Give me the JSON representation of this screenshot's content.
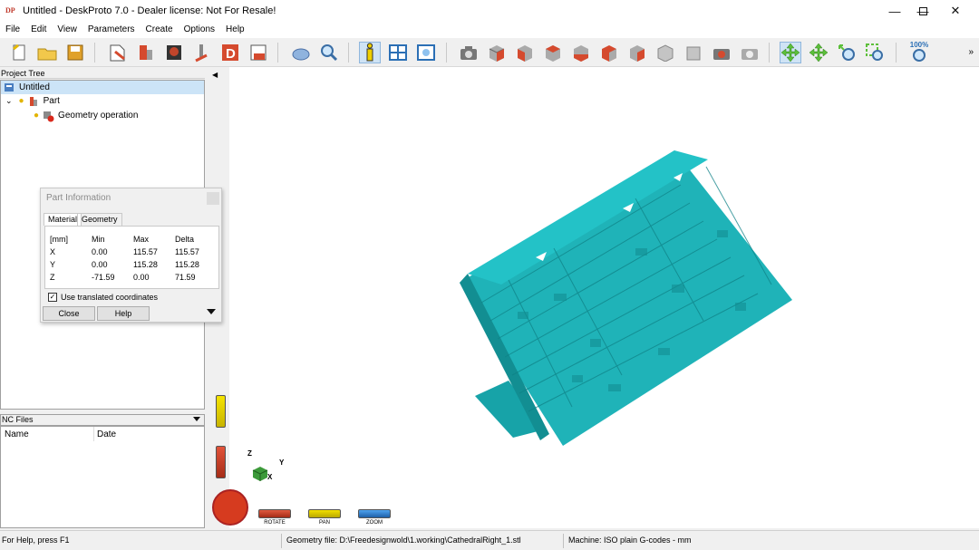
{
  "window": {
    "title": "Untitled - DeskProto 7.0 - Dealer license: Not For Resale!",
    "logo_text": "DP"
  },
  "menu": [
    "File",
    "Edit",
    "View",
    "Parameters",
    "Create",
    "Options",
    "Help"
  ],
  "toolbar": {
    "zoom_label": "100%",
    "colors": {
      "part": "#d54a2e",
      "gray": "#b7b7b7",
      "active_bg": "#cfe3f5",
      "accent_green": "#4caf50"
    }
  },
  "project_tree": {
    "title": "Project Tree",
    "items": [
      {
        "label": "Untitled",
        "icon": "project-icon",
        "selected": true
      },
      {
        "label": "Part",
        "icon": "part-icon"
      },
      {
        "label": "Geometry operation",
        "icon": "geometry-operation-icon"
      }
    ]
  },
  "nc_files": {
    "title": "NC Files",
    "columns": [
      "Name",
      "Date"
    ]
  },
  "part_info": {
    "title": "Part Information",
    "tabs": [
      "Material",
      "Geometry"
    ],
    "active_tab": "Material",
    "headers": [
      "[mm]",
      "Min",
      "Max",
      "Delta"
    ],
    "rows": [
      {
        "axis": "X",
        "min": "0.00",
        "max": "115.57",
        "delta": "115.57"
      },
      {
        "axis": "Y",
        "min": "0.00",
        "max": "115.28",
        "delta": "115.28"
      },
      {
        "axis": "Z",
        "min": "-71.59",
        "max": "0.00",
        "delta": "71.59"
      }
    ],
    "checkbox_label": "Use translated coordinates",
    "checkbox_checked": true,
    "close_label": "Close",
    "help_label": "Help"
  },
  "viewport": {
    "model_color": "#1fb3b8",
    "axes": {
      "z": "Z",
      "y": "Y",
      "x": "X"
    },
    "controls": {
      "rotate": "ROTATE",
      "pan": "PAN",
      "zoom": "ZOOM"
    }
  },
  "status": {
    "help": "For Help, press F1",
    "geometry": "Geometry file: D:\\Freedesignwold\\1.working\\CathedralRight_1.stl",
    "machine": "Machine: ISO plain G-codes - mm"
  }
}
